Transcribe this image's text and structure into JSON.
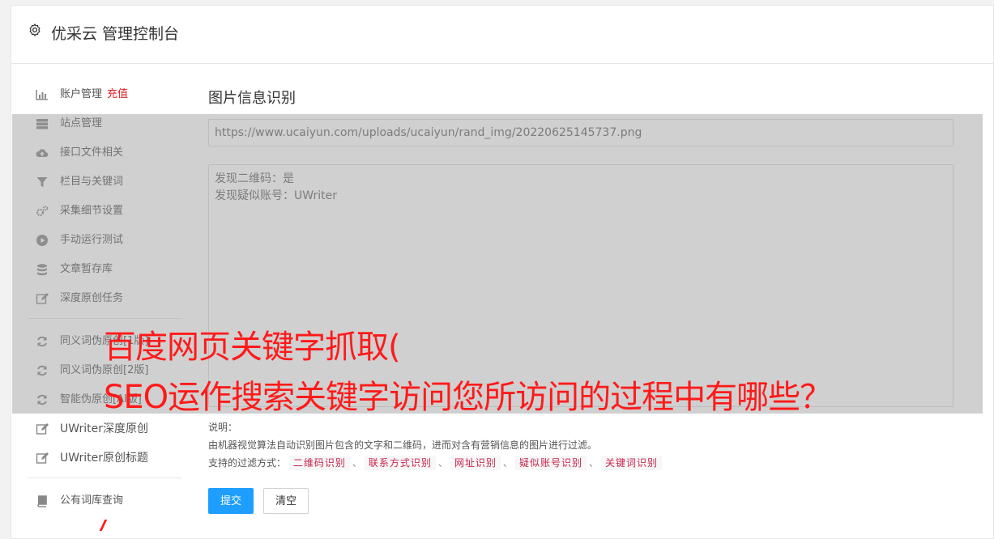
{
  "header": {
    "title": "优采云 管理控制台",
    "icon": "gear-icon"
  },
  "sidebar": {
    "items": [
      {
        "label": "账户管理",
        "extra": "充值",
        "icon": "bar-chart-icon"
      },
      {
        "label": "站点管理",
        "icon": "server-icon"
      },
      {
        "label": "接口文件相关",
        "icon": "cloud-upload-icon"
      },
      {
        "label": "栏目与关键词",
        "icon": "filter-icon"
      },
      {
        "label": "采集细节设置",
        "icon": "gears-icon"
      },
      {
        "label": "手动运行测试",
        "icon": "play-circle-icon"
      },
      {
        "label": "文章暂存库",
        "icon": "database-icon"
      },
      {
        "label": "深度原创任务",
        "icon": "edit-icon"
      }
    ],
    "items2": [
      {
        "label": "同义词伪原创[1版]",
        "icon": "refresh-icon"
      },
      {
        "label": "同义词伪原创[2版]",
        "icon": "refresh-icon"
      },
      {
        "label": "智能伪原创[AI版]",
        "icon": "refresh-icon"
      },
      {
        "label": "UWriter深度原创",
        "icon": "edit-icon"
      },
      {
        "label": "UWriter原创标题",
        "icon": "edit-icon"
      }
    ],
    "items3": [
      {
        "label": "公有词库查询",
        "icon": "book-icon"
      }
    ]
  },
  "main": {
    "title": "图片信息识别",
    "url_value": "https://www.ucaiyun.com/uploads/ucaiyun/rand_img/20220625145737.png",
    "result_lines": [
      "发现二维码：是",
      "发现疑似账号：UWriter"
    ],
    "note_title": "说明：",
    "note_desc": "由机器视觉算法自动识别图片包含的文字和二维码，进而对含有营销信息的图片进行过滤。",
    "filter_label": "支持的过滤方式：",
    "filters": [
      "二维码识别",
      "联系方式识别",
      "网址识别",
      "疑似账号识别",
      "关键词识别"
    ],
    "filter_sep": "、",
    "submit_label": "提交",
    "clear_label": "清空"
  },
  "overlay": {
    "line1": "百度网页关键字抓取(",
    "line2": "SEO运作搜索关键字访问您所访问的过程中有哪些？"
  },
  "colors": {
    "primary": "#1e9fff",
    "accent_red": "#e02020",
    "tag_text": "#c7254e"
  }
}
